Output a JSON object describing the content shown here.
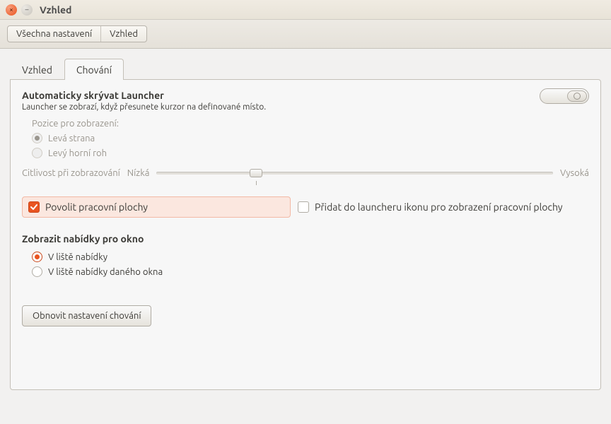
{
  "window": {
    "title": "Vzhled"
  },
  "breadcrumb": {
    "all": "Všechna nastavení",
    "current": "Vzhled"
  },
  "tabs": {
    "look": "Vzhled",
    "behavior": "Chování"
  },
  "launcher": {
    "title": "Automaticky skrývat Launcher",
    "desc": "Launcher se zobrazí, když přesunete kurzor na definované místo.",
    "position_label": "Pozice pro zobrazení:",
    "left_side": "Levá strana",
    "top_left": "Levý horní roh",
    "sensitivity_label": "Citlivost při zobrazování",
    "low": "Nízká",
    "high": "Vysoká"
  },
  "workspaces": {
    "enable": "Povolit pracovní plochy",
    "add_icon": "Přidat do launcheru ikonu pro zobrazení pracovní plochy"
  },
  "menus": {
    "title": "Zobrazit nabídky pro okno",
    "menubar": "V liště nabídky",
    "window_bar": "V liště nabídky daného okna"
  },
  "footer": {
    "restore": "Obnovit nastavení chování"
  }
}
